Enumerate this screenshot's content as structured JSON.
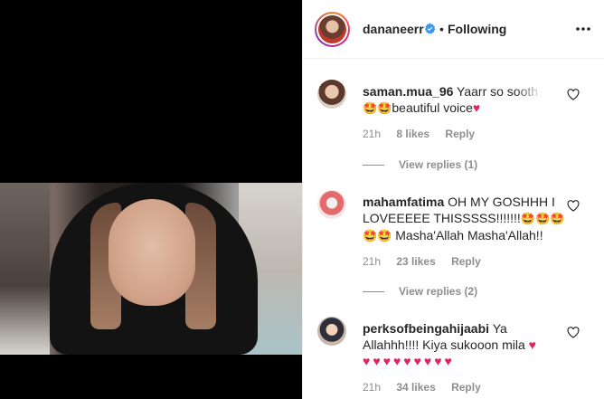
{
  "post": {
    "author": "dananeerr",
    "follow_state": "Following",
    "separator": "•"
  },
  "comments": [
    {
      "user": "saman.mua_96",
      "text_line1": "Yaarr so sooth",
      "emojis_line2": "🤩🤩",
      "text_line2": "beautiful voice",
      "heart_line2": "♥",
      "time": "21h",
      "likes": "8 likes",
      "reply": "Reply",
      "view_replies": "View replies (1)"
    },
    {
      "user": "mahamfatima",
      "text_line1": "OH MY GOSHHH I",
      "text_line2": "LOVEEEEE THISSSSS!!!!!!!",
      "emojis_line2": "🤩🤩🤩",
      "emojis_line3": "🤩🤩",
      "text_line3": "Masha'Allah Masha'Allah!!",
      "time": "21h",
      "likes": "23 likes",
      "reply": "Reply",
      "view_replies": "View replies (2)"
    },
    {
      "user": "perksofbeingahijaabi",
      "text_line1": "Ya",
      "text_line2": "Allahhh!!!! Kiya sukooon mila",
      "heart_line2": "♥",
      "hearts_line3": "♥♥♥♥♥♥♥♥♥",
      "time": "21h",
      "likes": "34 likes",
      "reply": "Reply"
    }
  ],
  "colors": {
    "verified": "#3897f0",
    "heart": "#e0245e",
    "meta": "#8e8e8e",
    "text": "#262626"
  },
  "icons": {
    "verified": "verified-badge-icon",
    "more": "more-options-icon",
    "like": "heart-outline-icon"
  }
}
